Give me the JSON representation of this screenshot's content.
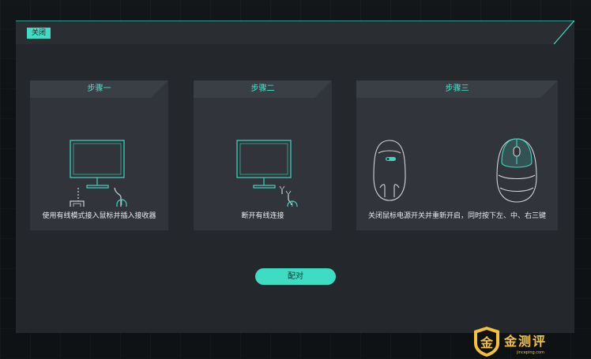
{
  "dialog": {
    "close_label": "关闭"
  },
  "steps": [
    {
      "title": "步骤一",
      "description": "使用有线模式接入鼠标并插入接收器",
      "illustration": "monitor-mouse-receiver-icon"
    },
    {
      "title": "步骤二",
      "description": "断开有线连接",
      "illustration": "monitor-mouse-disconnect-icon"
    },
    {
      "title": "步骤三",
      "description": "关闭鼠标电源开关并重新开启，同时按下左、中、右三键",
      "illustration": "mouse-bottom-top-icon"
    }
  ],
  "pair_button": {
    "label": "配对"
  },
  "watermark": {
    "title": "金测评",
    "url": "jinceping.com",
    "badge_glyph": "金"
  },
  "colors": {
    "accent": "#3fdcc4",
    "panel": "#24272c",
    "card": "#31353b",
    "watermark": "#f3c23b"
  }
}
